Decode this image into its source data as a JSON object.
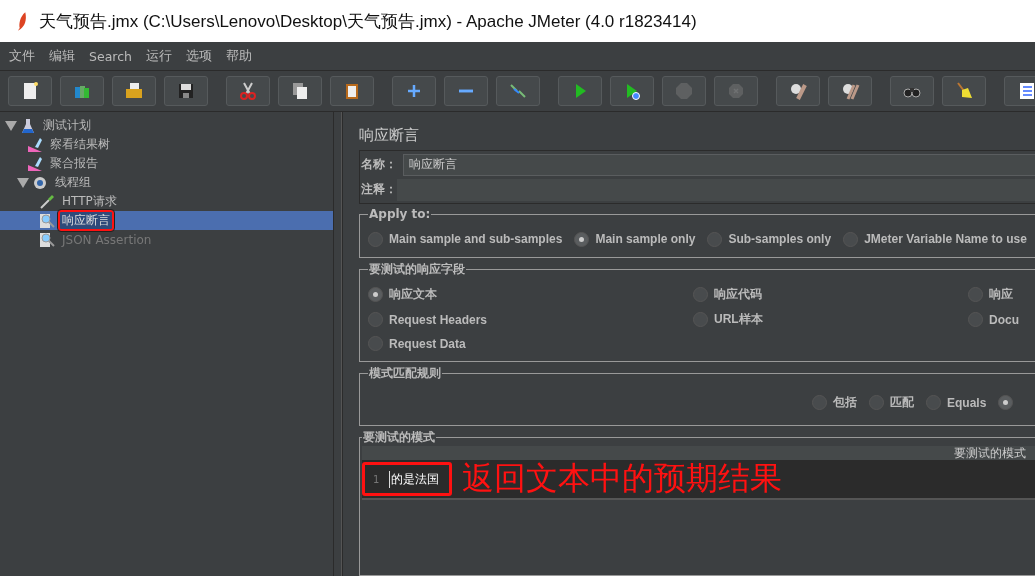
{
  "window": {
    "title": "天气预告.jmx (C:\\Users\\Lenovo\\Desktop\\天气预告.jmx) - Apache JMeter (4.0 r1823414)"
  },
  "menu": [
    {
      "label": "文件"
    },
    {
      "label": "编辑"
    },
    {
      "label": "Search"
    },
    {
      "label": "运行"
    },
    {
      "label": "选项"
    },
    {
      "label": "帮助"
    }
  ],
  "toolbar_groups": [
    [
      {
        "kind": "new",
        "disabled": false
      },
      {
        "kind": "templates",
        "disabled": false
      },
      {
        "kind": "open",
        "disabled": false
      },
      {
        "kind": "save",
        "disabled": false
      }
    ],
    [
      {
        "kind": "cut",
        "disabled": false
      },
      {
        "kind": "copy",
        "disabled": false
      },
      {
        "kind": "paste",
        "disabled": false
      }
    ],
    [
      {
        "kind": "expand",
        "disabled": false
      },
      {
        "kind": "collapse",
        "disabled": false
      },
      {
        "kind": "toggle",
        "disabled": false
      }
    ],
    [
      {
        "kind": "start",
        "disabled": false
      },
      {
        "kind": "start-no-pause",
        "disabled": false
      },
      {
        "kind": "stop",
        "disabled": true
      },
      {
        "kind": "shutdown",
        "disabled": true
      }
    ],
    [
      {
        "kind": "clear",
        "disabled": false
      },
      {
        "kind": "clear-all",
        "disabled": false
      }
    ],
    [
      {
        "kind": "search",
        "disabled": false
      },
      {
        "kind": "reset-search",
        "disabled": false
      }
    ],
    [
      {
        "kind": "log",
        "disabled": false
      }
    ]
  ],
  "tree": [
    {
      "label": "测试计划",
      "kind": "plan",
      "expanded": true,
      "selected": false,
      "disabled": false,
      "highlighted": false,
      "children": [
        {
          "label": "察看结果树",
          "kind": "listener",
          "selected": false,
          "disabled": false,
          "highlighted": false
        },
        {
          "label": "聚合报告",
          "kind": "listener",
          "selected": false,
          "disabled": false,
          "highlighted": false
        },
        {
          "label": "线程组",
          "kind": "threads",
          "expanded": true,
          "selected": false,
          "disabled": false,
          "highlighted": false,
          "children": [
            {
              "label": "HTTP请求",
              "kind": "sampler",
              "selected": false,
              "disabled": false,
              "highlighted": false
            },
            {
              "label": "响应断言",
              "kind": "assertion",
              "selected": true,
              "disabled": false,
              "highlighted": true
            },
            {
              "label": "JSON Assertion",
              "kind": "assertion",
              "selected": false,
              "disabled": true,
              "highlighted": false
            }
          ]
        }
      ]
    }
  ],
  "panel": {
    "title": "响应断言",
    "name_field": {
      "label": "名称：",
      "value": "响应断言"
    },
    "comment_field": {
      "label": "注释："
    },
    "apply_to": {
      "legend": "Apply to:",
      "options": [
        {
          "label": "Main sample and sub-samples",
          "selected": false
        },
        {
          "label": "Main sample only",
          "selected": true
        },
        {
          "label": "Sub-samples only",
          "selected": false
        },
        {
          "label": "JMeter Variable Name to use",
          "selected": false
        }
      ]
    },
    "response_field": {
      "legend": "要测试的响应字段",
      "options": [
        {
          "label": "响应文本",
          "selected": true
        },
        {
          "label": "响应代码",
          "selected": false
        },
        {
          "label": "响应",
          "selected": false
        },
        {
          "label": "Request Headers",
          "selected": false
        },
        {
          "label": "URL样本",
          "selected": false
        },
        {
          "label": "Docu",
          "selected": false
        },
        {
          "label": "Request Data",
          "selected": false
        }
      ]
    },
    "pattern_rules": {
      "legend": "模式匹配规则",
      "options": [
        {
          "label": "包括",
          "selected": false
        },
        {
          "label": "匹配",
          "selected": false
        },
        {
          "label": "Equals",
          "selected": false
        },
        {
          "selected": true
        }
      ]
    },
    "patterns": {
      "legend": "要测试的模式",
      "column_header": "要测试的模式",
      "highlighted": true,
      "lines": [
        {
          "number": "1",
          "text": "的是法国"
        }
      ]
    }
  },
  "annotation": {
    "text": "返回文本中的预期结果"
  }
}
